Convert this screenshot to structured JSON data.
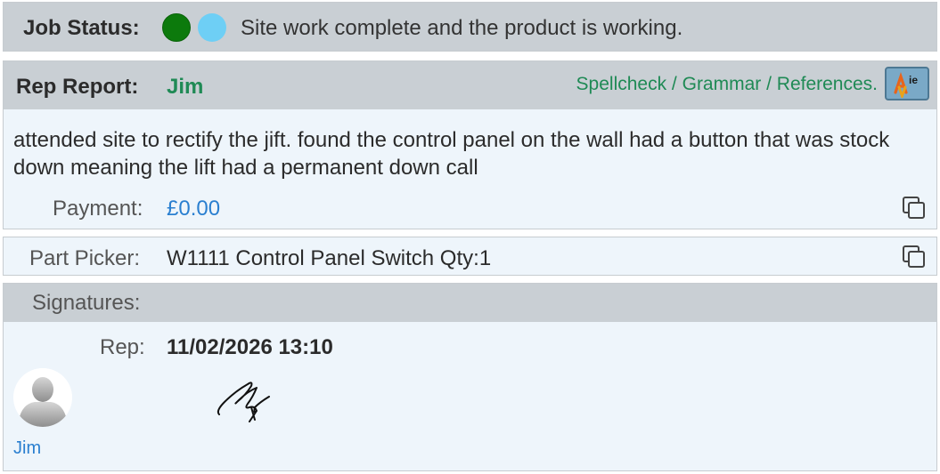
{
  "job_status": {
    "label": "Job Status:",
    "indicators": [
      {
        "name": "complete",
        "color": "#0c7a0c"
      },
      {
        "name": "working",
        "color": "#6ecff5"
      }
    ],
    "text": "Site work complete and the product is working."
  },
  "rep_report": {
    "label": "Rep Report:",
    "rep_name": "Jim",
    "tools_link": "Spellcheck / Grammar / References.",
    "tools_icon": "spellcheck-logo-icon",
    "body": "attended site to rectify the jift. found the control panel on the wall had a button that was stock down meaning the lift had a permanent down call",
    "payment_label": "Payment:",
    "payment_value": "£0.00"
  },
  "part_picker": {
    "label": "Part Picker:",
    "value": "W1111 Control Panel Switch Qty:1"
  },
  "signatures": {
    "label": "Signatures:",
    "rep_label": "Rep:",
    "rep_datetime": "11/02/2026 13:10",
    "signer_name": "Jim"
  },
  "colors": {
    "header_grey": "#c9cfd4",
    "body_light": "#eef5fb",
    "accent_green": "#1f8a55",
    "link_blue": "#2a7fd0"
  }
}
